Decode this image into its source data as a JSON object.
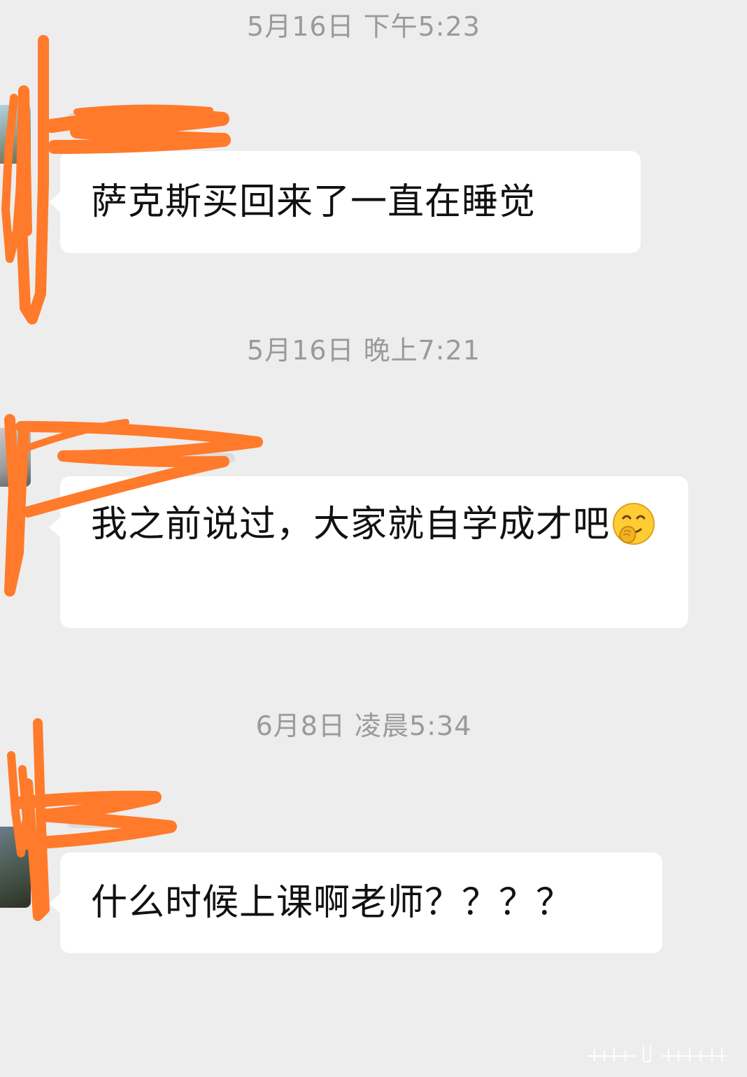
{
  "chat": {
    "messages": [
      {
        "time": "5月16日 下午5:23",
        "text": "萨克斯买回来了一直在睡觉"
      },
      {
        "time": "5月16日 晚上7:21",
        "text": "我之前说过，大家就自学成才吧",
        "emoji": "smirk-face-icon"
      },
      {
        "time": "6月8日 凌晨5:34",
        "text": "什么时候上课啊老师？？？？"
      }
    ]
  },
  "colors": {
    "background": "#ededed",
    "bubble": "#ffffff",
    "timestamp": "#9a9a9a",
    "redaction": "#ff7a2a"
  }
}
